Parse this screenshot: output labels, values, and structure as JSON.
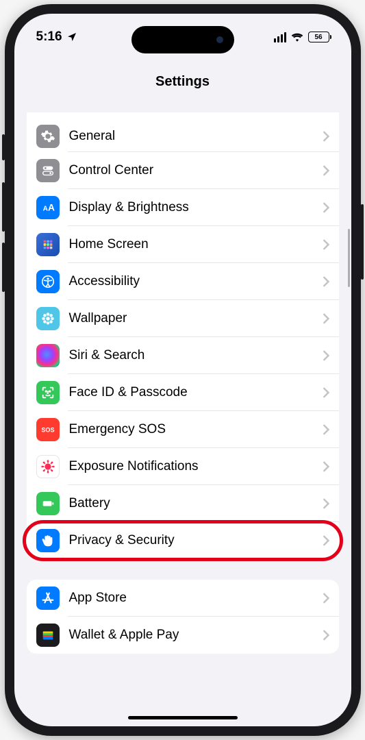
{
  "status": {
    "time": "5:16",
    "battery": "56"
  },
  "page_title": "Settings",
  "groups": [
    {
      "items": [
        {
          "id": "general",
          "label": "General",
          "icon": "gear",
          "bg": "bg-gray"
        },
        {
          "id": "control-center",
          "label": "Control Center",
          "icon": "toggles",
          "bg": "bg-gray"
        },
        {
          "id": "display-brightness",
          "label": "Display & Brightness",
          "icon": "aa",
          "bg": "bg-blue"
        },
        {
          "id": "home-screen",
          "label": "Home Screen",
          "icon": "grid",
          "bg": "bg-dblue"
        },
        {
          "id": "accessibility",
          "label": "Accessibility",
          "icon": "person",
          "bg": "bg-blue"
        },
        {
          "id": "wallpaper",
          "label": "Wallpaper",
          "icon": "flower",
          "bg": "bg-cyan"
        },
        {
          "id": "siri-search",
          "label": "Siri & Search",
          "icon": "siri",
          "bg": "bg-black"
        },
        {
          "id": "faceid-passcode",
          "label": "Face ID & Passcode",
          "icon": "faceid",
          "bg": "bg-green"
        },
        {
          "id": "emergency-sos",
          "label": "Emergency SOS",
          "icon": "sos",
          "bg": "bg-red"
        },
        {
          "id": "exposure-notifications",
          "label": "Exposure Notifications",
          "icon": "virus",
          "bg": "bg-white"
        },
        {
          "id": "battery",
          "label": "Battery",
          "icon": "battery",
          "bg": "bg-green"
        },
        {
          "id": "privacy-security",
          "label": "Privacy & Security",
          "icon": "hand",
          "bg": "bg-blue",
          "highlighted": true
        }
      ]
    },
    {
      "items": [
        {
          "id": "app-store",
          "label": "App Store",
          "icon": "appstore",
          "bg": "bg-blue"
        },
        {
          "id": "wallet-apple-pay",
          "label": "Wallet & Apple Pay",
          "icon": "wallet",
          "bg": "bg-black"
        }
      ]
    }
  ]
}
